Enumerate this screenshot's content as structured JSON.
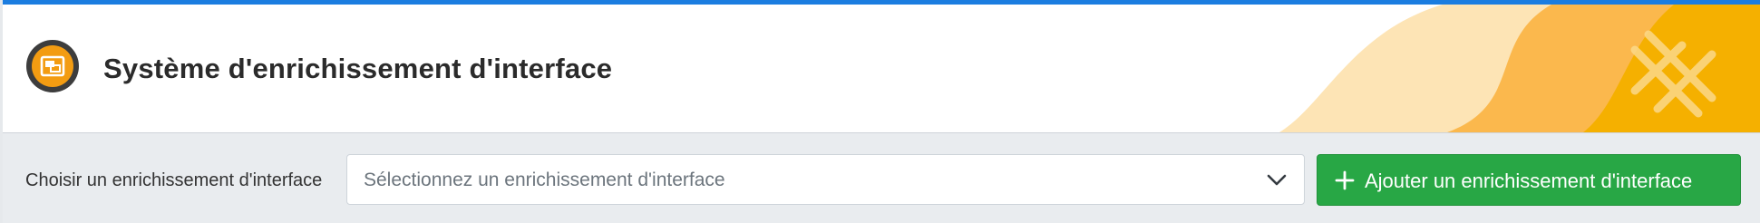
{
  "header": {
    "title": "Système d'enrichissement d'interface",
    "icon": "window-layers-icon"
  },
  "toolbar": {
    "choose_label": "Choisir un enrichissement d'interface",
    "select": {
      "placeholder": "Sélectionnez un enrichissement d'interface"
    },
    "add_button_label": "Ajouter un enrichissement d'interface"
  },
  "colors": {
    "top_accent": "#1b7de0",
    "brand_orange": "#f39c12",
    "add_button": "#28a745",
    "toolbar_bg": "#e9ecef",
    "deco_light": "#fde4b5",
    "deco_mid": "#fbb84d",
    "deco_dark": "#f5b000"
  },
  "icons": {
    "app": "window-layers-icon",
    "select_arrow": "chevron-down-icon",
    "add": "plus-icon",
    "deco": "x-lines-icon"
  }
}
